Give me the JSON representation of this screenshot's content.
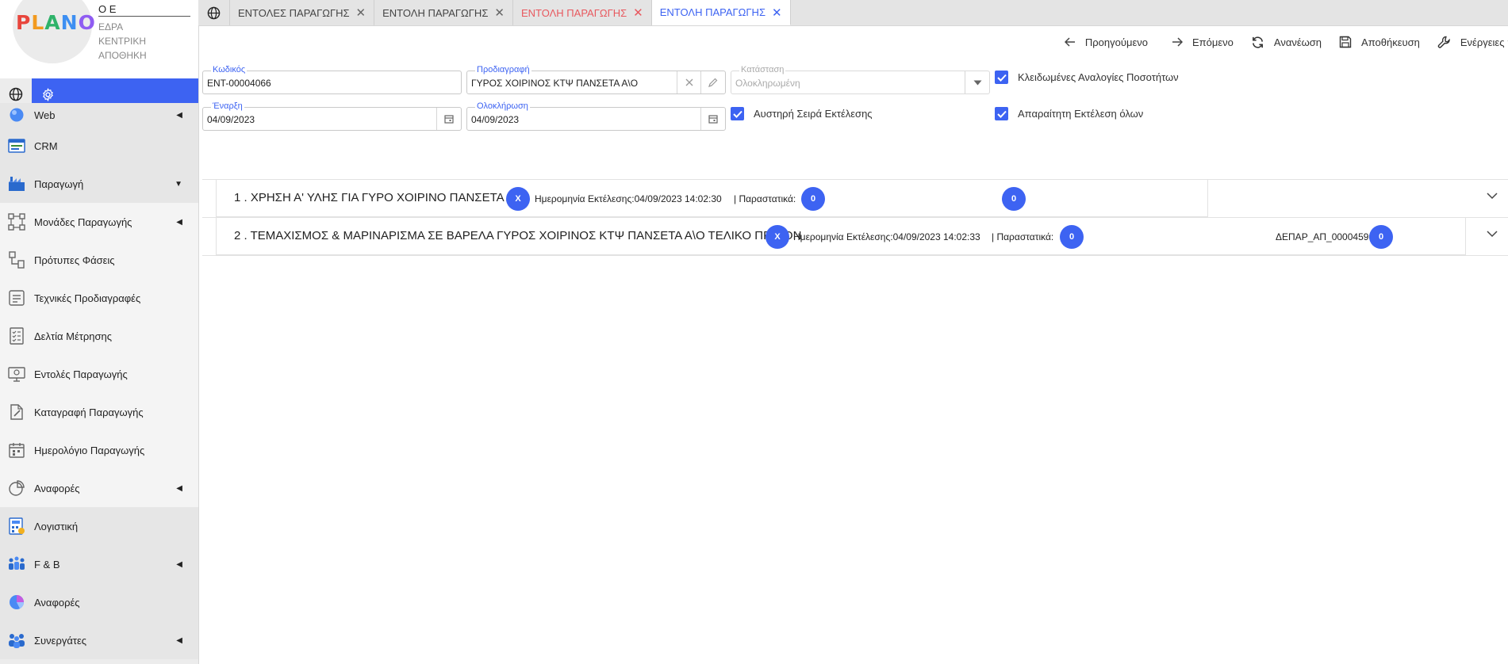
{
  "brand": {
    "logo_text": "PLANO",
    "company": "Ο Ε",
    "branch": [
      "ΕΔΡΑ",
      "ΚΕΝΤΡΙΚΗ",
      "ΑΠΟΘΗΚΗ"
    ],
    "accent": "#3d63f2",
    "logo_colors": [
      "#e8453c",
      "#f29a1f",
      "#2fb36a",
      "#3d8ff2",
      "#8f5cf2"
    ]
  },
  "sidebar": {
    "items": [
      {
        "label": "Web",
        "icon": "web-globe-icon",
        "expand": "left-arrow",
        "level": "top"
      },
      {
        "label": "CRM",
        "icon": "crm-icon",
        "level": "top"
      },
      {
        "label": "Παραγωγή",
        "icon": "production-icon",
        "expand": "down-arrow",
        "level": "top"
      },
      {
        "label": "Μονάδες Παραγωγής",
        "icon": "units-icon",
        "expand": "left-arrow",
        "level": "sub"
      },
      {
        "label": "Πρότυπες Φάσεις",
        "icon": "phases-icon",
        "level": "sub"
      },
      {
        "label": "Τεχνικές Προδιαγραφές",
        "icon": "specs-icon",
        "level": "sub"
      },
      {
        "label": "Δελτία Μέτρησης",
        "icon": "measurement-icon",
        "level": "sub"
      },
      {
        "label": "Εντολές Παραγωγής",
        "icon": "orders-icon",
        "level": "sub"
      },
      {
        "label": "Καταγραφή Παραγωγής",
        "icon": "record-icon",
        "level": "sub"
      },
      {
        "label": "Ημερολόγιο Παραγωγής",
        "icon": "calendar-icon",
        "level": "sub"
      },
      {
        "label": "Αναφορές",
        "icon": "reports-pie-icon",
        "expand": "left-arrow",
        "level": "sub"
      },
      {
        "label": "Λογιστική",
        "icon": "accounting-icon",
        "level": "top"
      },
      {
        "label": "F & B",
        "icon": "fnb-icon",
        "expand": "left-arrow",
        "level": "top"
      },
      {
        "label": "Αναφορές",
        "icon": "reports-icon",
        "level": "top"
      },
      {
        "label": "Συνεργάτες",
        "icon": "partners-icon",
        "expand": "left-arrow",
        "level": "top"
      }
    ]
  },
  "tabs": [
    {
      "label": "ΕΝΤΟΛΕΣ ΠΑΡΑΓΩΓΗΣ",
      "state": "normal"
    },
    {
      "label": "ΕΝΤΟΛΗ ΠΑΡΑΓΩΓΗΣ",
      "state": "normal"
    },
    {
      "label": "ΕΝΤΟΛΗ ΠΑΡΑΓΩΓΗΣ",
      "state": "error"
    },
    {
      "label": "ΕΝΤΟΛΗ ΠΑΡΑΓΩΓΗΣ",
      "state": "active"
    }
  ],
  "toolbar": {
    "previous": "Προηγούμενο",
    "next": "Επόμενο",
    "refresh": "Ανανέωση",
    "save": "Αποθήκευση",
    "actions": "Ενέργειες"
  },
  "form": {
    "code_label": "Κωδικός",
    "code_value": "ENT-00004066",
    "spec_label": "Προδιαγραφή",
    "spec_value": "ΓΥΡΟΣ ΧΟΙΡΙΝΟΣ ΚΤΨ ΠΑΝΣΕΤΑ Α\\Ο",
    "status_label": "Κατάσταση",
    "status_value": "Ολοκληρωμένη",
    "start_label": "Έναρξη",
    "start_value": "04/09/2023",
    "end_label": "Ολοκλήρωση",
    "end_value": "04/09/2023",
    "locked_ratios": "Κλειδωμένες Αναλογίες Ποσοτήτων",
    "strict_order": "Αυστηρή Σειρά Εκτέλεσης",
    "require_all": "Απαραίτητη Εκτέλεση όλων"
  },
  "rows": [
    {
      "title": "1 . ΧΡΗΣΗ Α' ΥΛΗΣ ΓΙΑ ΓΥΡΟ ΧΟΙΡΙΝΟ ΠΑΝΣΕΤΑ Α\\Ο",
      "badge_x": "X",
      "exec_text": "Ημερομηνία Εκτέλεσης:04/09/2023 14:02:30",
      "docs_text": "| Παραστατικά:",
      "badge_docs": "0",
      "ref": "",
      "badge_ref": "0"
    },
    {
      "title": "2 . ΤΕΜΑΧΙΣΜΟΣ & ΜΑΡΙΝΑΡΙΣΜΑ ΣΕ ΒΑΡΕΛΑ ΓΥΡΟΣ ΧΟΙΡΙΝΟΣ ΚΤΨ ΠΑΝΣΕΤΑ Α\\Ο ΤΕΛΙΚΟ ΠΡΟΙΟΝ",
      "badge_x": "X",
      "exec_text": "Ημερομηνία Εκτέλεσης:04/09/2023 14:02:33",
      "docs_text": "| Παραστατικά:",
      "badge_docs": "0",
      "ref": "ΔΕΠΑΡ_ΑΠ_00004596",
      "badge_ref": "0"
    }
  ]
}
